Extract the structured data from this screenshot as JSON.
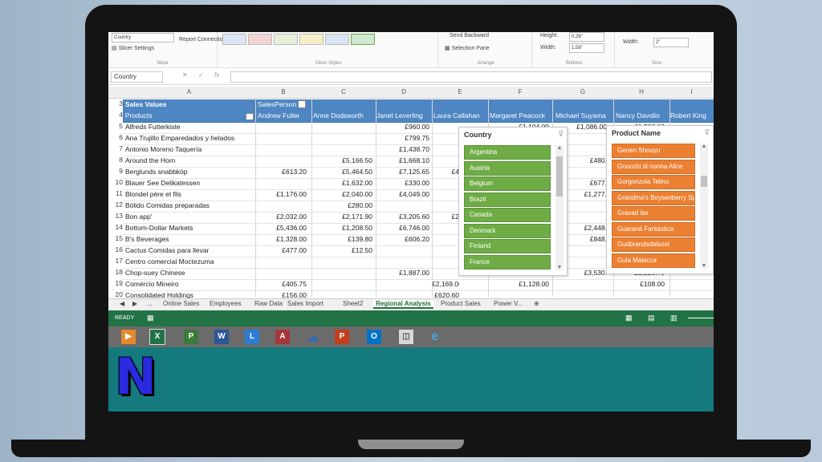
{
  "ribbon": {
    "slicer_settings": "Slicer Settings",
    "report_connections": "Report Connections",
    "caption_value": "Country",
    "group_slicer": "Slicer",
    "group_styles": "Slicer Styles",
    "send_backward": "Send Backward",
    "selection_pane": "Selection Pane",
    "group_arrange": "Arrange",
    "height_label": "Height:",
    "height_value": "0.26\"",
    "width_label": "Width:",
    "width_value": "1.58\"",
    "group_buttons": "Buttons",
    "size_width_label": "Width:",
    "size_width_value": "2\"",
    "group_size": "Size"
  },
  "formula": {
    "name_box": "Country",
    "fx": "fx",
    "cancel": "✕",
    "enter": "✓"
  },
  "columns": [
    "A",
    "B",
    "C",
    "D",
    "E",
    "F",
    "G",
    "H",
    "I"
  ],
  "header": {
    "row3_num": "3",
    "row3_label": "Sales Values",
    "row3_sp": "SalesPerson",
    "row4_num": "4",
    "row4_label": "Products",
    "people": [
      "Andrew Fuller",
      "Anne Dodsworth",
      "Janet Leverling",
      "Laura Callahan",
      "Margaret Peacock",
      "Michael Suyama",
      "Nancy Davolio",
      "Robert King"
    ]
  },
  "rows": [
    {
      "n": "5",
      "name": "Alfreds Futterkiste",
      "b": "",
      "c": "",
      "d": "£960.00",
      "e": "",
      "f": "£1,104.00",
      "g": "£1,086.00",
      "h": "£1,296.00"
    },
    {
      "n": "6",
      "name": "Ana Trujillo Emparedados y helados",
      "b": "",
      "c": "",
      "d": "£799.75",
      "e": "",
      "f": "",
      "g": "",
      "h": ""
    },
    {
      "n": "7",
      "name": "Antonio Moreno Taquería",
      "b": "",
      "c": "",
      "d": "£1,438.70",
      "e": "",
      "f": "",
      "g": "",
      "h": ""
    },
    {
      "n": "8",
      "name": "Around the Horn",
      "b": "",
      "c": "£5,166.50",
      "d": "£1,668.10",
      "e": "",
      "f": "",
      "g": "£480.",
      "h": ""
    },
    {
      "n": "9",
      "name": "Berglunds snabbköp",
      "b": "£613.20",
      "c": "£5,464.50",
      "d": "£7,125.65",
      "e": "£4",
      "f": "",
      "g": "",
      "h": ""
    },
    {
      "n": "10",
      "name": "Blauer See Delikatessen",
      "b": "",
      "c": "£1,632.00",
      "d": "£330.00",
      "e": "",
      "f": "",
      "g": "£677.",
      "h": ""
    },
    {
      "n": "11",
      "name": "Blondel père et fils",
      "b": "£1,176.00",
      "c": "£2,040.00",
      "d": "£4,049.00",
      "e": "",
      "f": "",
      "g": "£1,277.",
      "h": ""
    },
    {
      "n": "12",
      "name": "Bólido Comidas preparadas",
      "b": "",
      "c": "£280.00",
      "d": "",
      "e": "",
      "f": "",
      "g": "",
      "h": ""
    },
    {
      "n": "13",
      "name": "Bon app'",
      "b": "£2,032.00",
      "c": "£2,171.90",
      "d": "£3,205.60",
      "e": "£2",
      "f": "",
      "g": "",
      "h": ""
    },
    {
      "n": "14",
      "name": "Bottom-Dollar Markets",
      "b": "£5,436.00",
      "c": "£1,208.50",
      "d": "£6,746.00",
      "e": "",
      "f": "",
      "g": "£2,448.",
      "h": ""
    },
    {
      "n": "15",
      "name": "B's Beverages",
      "b": "£1,328.00",
      "c": "£139.80",
      "d": "£606.20",
      "e": "",
      "f": "",
      "g": "£848.",
      "h": ""
    },
    {
      "n": "16",
      "name": "Cactus Comidas para llevar",
      "b": "£477.00",
      "c": "£12.50",
      "d": "",
      "e": "",
      "f": "",
      "g": "",
      "h": ""
    },
    {
      "n": "17",
      "name": "Centro comercial Moctezuma",
      "b": "",
      "c": "",
      "d": "",
      "e": "",
      "f": "",
      "g": "",
      "h": ""
    },
    {
      "n": "18",
      "name": "Chop-suey Chinese",
      "b": "",
      "c": "",
      "d": "£1,887.00",
      "e": "",
      "f": "",
      "g": "£3,530.",
      "h": "£1,126.70"
    },
    {
      "n": "19",
      "name": "Comércio Mineiro",
      "b": "£405.75",
      "c": "",
      "d": "",
      "e": "£2,169.00",
      "f": "£1,128.00",
      "g": "",
      "h": "£108.00"
    },
    {
      "n": "20",
      "name": "Consolidated Holdings",
      "b": "£156.00",
      "c": "",
      "d": "",
      "e": "£620.60",
      "f": "",
      "g": "",
      "h": ""
    }
  ],
  "slicer_country": {
    "title": "Country",
    "items": [
      "Argentina",
      "Austria",
      "Belgium",
      "Brazil",
      "Canada",
      "Denmark",
      "Finland",
      "France"
    ],
    "color": "#6fac46"
  },
  "slicer_product": {
    "title": "Product Name",
    "items": [
      "Genen Shouyu",
      "Gnocchi di nonna Alice",
      "Gorgonzola Telino",
      "Grandma's Boysenberry Spread",
      "Gravad lax",
      "Guaraná Fantástica",
      "Gudbrandsdalsost",
      "Gula Malacca"
    ],
    "color": "#ec8032"
  },
  "tabs": {
    "items": [
      "Online Sales",
      "Employees",
      "Raw Data",
      "Sales Import",
      "Sheet2",
      "Regional Analysis",
      "Product Sales",
      "Power V..."
    ],
    "active": "Regional Analysis",
    "ellipsis": "..."
  },
  "status": {
    "ready": "READY"
  },
  "taskbar": [
    "media",
    "excel",
    "project",
    "word",
    "lync",
    "access",
    "onedrive",
    "powerpoint",
    "outlook",
    "store",
    "internet-explorer"
  ],
  "logo": {
    "letter": "N"
  }
}
